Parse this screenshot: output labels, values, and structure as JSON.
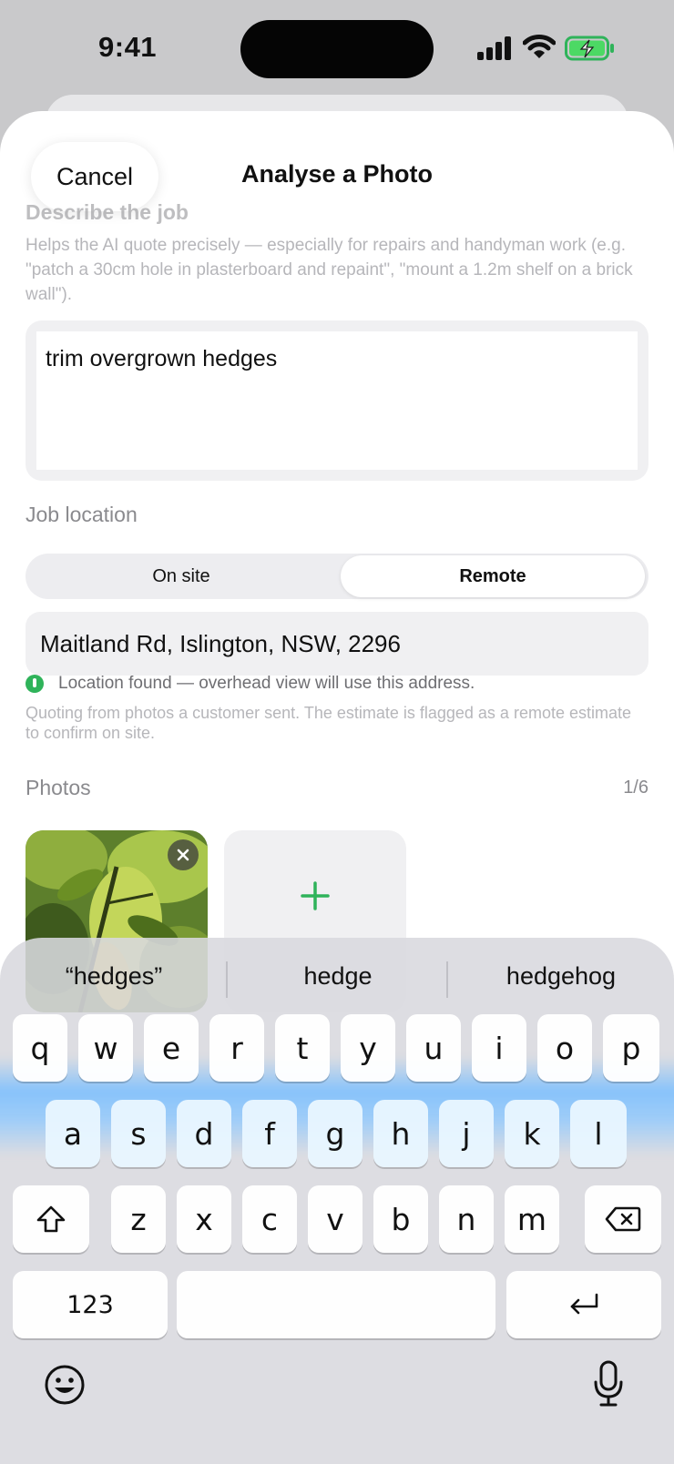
{
  "status_bar": {
    "time": "9:41"
  },
  "header": {
    "cancel_label": "Cancel",
    "title": "Analyse a Photo"
  },
  "describe": {
    "label": "Describe the job",
    "help": "Helps the AI quote precisely — especially for repairs and handyman work (e.g. \"patch a 30cm hole in plasterboard and repaint\", \"mount a 1.2m shelf on a brick wall\").",
    "value": "trim overgrown hedges"
  },
  "location": {
    "label": "Job location",
    "options": [
      "On site",
      "Remote"
    ],
    "selected": "Remote",
    "address": "Maitland Rd, Islington, NSW, 2296",
    "found_text": "Location found — overhead view will use this address.",
    "help": "Quoting from photos a customer sent. The estimate is flagged as a remote estimate to confirm on site."
  },
  "photos": {
    "label": "Photos",
    "count": "1/6"
  },
  "keyboard": {
    "suggestions": [
      "“hedges”",
      "hedge",
      "hedgehog"
    ],
    "row1": [
      "q",
      "w",
      "e",
      "r",
      "t",
      "y",
      "u",
      "i",
      "o",
      "p"
    ],
    "row2": [
      "a",
      "s",
      "d",
      "f",
      "g",
      "h",
      "j",
      "k",
      "l"
    ],
    "row3": [
      "z",
      "x",
      "c",
      "v",
      "b",
      "n",
      "m"
    ],
    "numbers_label": "123"
  },
  "colors": {
    "accent_green": "#2fb35a",
    "glow_blue": "#78beff"
  }
}
